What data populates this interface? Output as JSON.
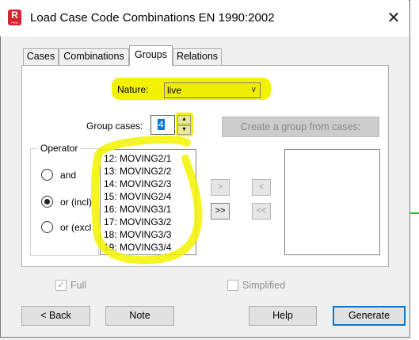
{
  "window": {
    "title": "Load Case Code Combinations EN 1990:2002",
    "app_icon_letter": "R",
    "app_icon_sub": "PRO",
    "close_glyph": "✕"
  },
  "tabs": [
    {
      "label": "Cases",
      "active": false
    },
    {
      "label": "Combinations",
      "active": false
    },
    {
      "label": "Groups",
      "active": true
    },
    {
      "label": "Relations",
      "active": false
    }
  ],
  "nature": {
    "label": "Nature:",
    "value": "live"
  },
  "group_cases": {
    "label": "Group cases:",
    "value": "4"
  },
  "create_group_button": "Create a group from cases:",
  "operator": {
    "title": "Operator",
    "options": [
      {
        "label": "and",
        "selected": false
      },
      {
        "label": "or (incl)",
        "selected": true
      },
      {
        "label": "or (excl",
        "selected": false
      }
    ]
  },
  "cases_list": [
    "12: MOVING2/1",
    "13: MOVING2/2",
    "14: MOVING2/3",
    "15: MOVING2/4",
    "16: MOVING3/1",
    "17: MOVING3/2",
    "18: MOVING3/3",
    "19: MOVING3/4"
  ],
  "transfer_buttons": {
    "add_one": ">",
    "add_all": ">>",
    "remove_one": "<",
    "remove_all": "<<"
  },
  "checkboxes": {
    "full": "Full",
    "full_checked": true,
    "simplified": "Simplified",
    "simplified_checked": false
  },
  "buttons": {
    "back": "< Back",
    "note": "Note",
    "help": "Help",
    "generate": "Generate"
  },
  "colors": {
    "highlight": "#f3f300",
    "accent": "#0078d7",
    "app_icon": "#d6232f"
  }
}
